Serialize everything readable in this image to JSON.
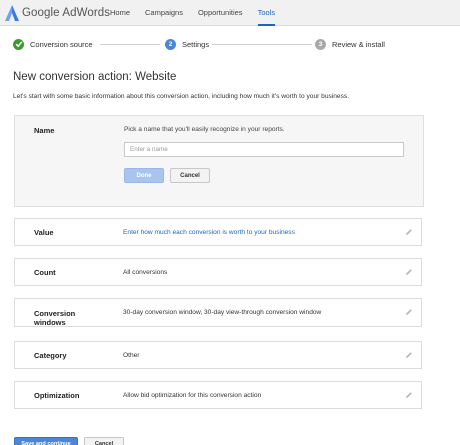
{
  "header": {
    "logo_text": "Google AdWords",
    "nav": [
      "Home",
      "Campaigns",
      "Opportunities",
      "Tools"
    ],
    "active_nav": "Tools"
  },
  "stepper": {
    "steps": [
      {
        "label": "Conversion source",
        "marker": "check-icon",
        "state": "complete"
      },
      {
        "label": "Settings",
        "marker": "2",
        "state": "active"
      },
      {
        "label": "Review & install",
        "marker": "3",
        "state": "upcoming"
      }
    ]
  },
  "page": {
    "title": "New conversion action: Website",
    "intro": "Let's start with some basic information about this conversion action, including how much it's worth to your business."
  },
  "name_card": {
    "label": "Name",
    "hint": "Pick a name that you'll easily recognize in your reports.",
    "placeholder": "Enter a name",
    "value": "",
    "done_label": "Done",
    "cancel_label": "Cancel"
  },
  "settings": [
    {
      "label": "Value",
      "value": "Enter how much each conversion is worth to your business",
      "is_link": true
    },
    {
      "label": "Count",
      "value": "All conversions",
      "is_link": false
    },
    {
      "label": "Conversion windows",
      "value": "30-day conversion window, 30-day view-through conversion window",
      "is_link": false
    },
    {
      "label": "Category",
      "value": "Other",
      "is_link": false
    },
    {
      "label": "Optimization",
      "value": "Allow bid optimization for this conversion action",
      "is_link": false
    }
  ],
  "footer": {
    "save_label": "Save and continue",
    "cancel_label": "Cancel"
  },
  "colors": {
    "accent_blue": "#4a87d8",
    "link_blue": "#1a66c8",
    "complete_green": "#3c9a2f"
  }
}
